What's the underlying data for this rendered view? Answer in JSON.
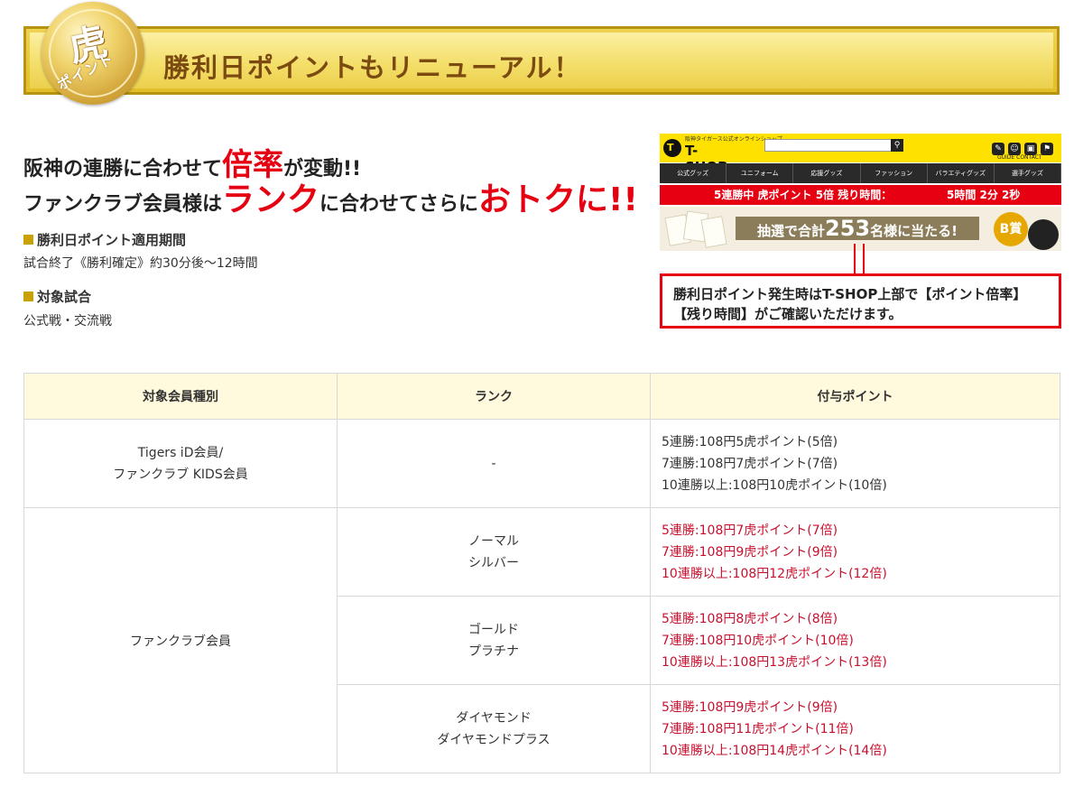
{
  "banner": {
    "medal_kanji": "虎",
    "medal_sub": "ポイント",
    "title": "勝利日ポイントもリニューアル！"
  },
  "headline": {
    "l1_a": "阪神の連勝に合わせて",
    "l1_big": "倍率",
    "l1_b": "が変動!!",
    "l2_a": "ファンクラブ会員様は",
    "l2_big1": "ランク",
    "l2_b": "に合わせてさらに",
    "l2_big2": "おトクに!!"
  },
  "period": {
    "heading": "勝利日ポイント適用期間",
    "text": "試合終了《勝利確定》約30分後〜12時間"
  },
  "target": {
    "heading": "対象試合",
    "text": "公式戦・交流戦"
  },
  "shop_screenshot": {
    "logo_caption": "阪神タイガース公式オンラインショップ",
    "logo_text": "T-SHOP",
    "guide_text": "GUIDE  CONTACT",
    "nav": [
      "公式グッズ",
      "ユニフォーム",
      "応援グッズ",
      "ファッション",
      "バラエティグッズ",
      "選手グッズ"
    ],
    "red_bar_a": "5連勝中 虎ポイント 5倍 残り時間：",
    "red_bar_b": "5時間 2分 2秒",
    "lottery_a": "抽選で合計",
    "lottery_num": "253",
    "lottery_b": "名様に当たる!",
    "prize": "B賞"
  },
  "callout": {
    "line1": "勝利日ポイント発生時はT-SHOP上部で【ポイント倍率】",
    "line2": "【残り時間】がご確認いただけます。"
  },
  "table": {
    "headers": [
      "対象会員種別",
      "ランク",
      "付与ポイント"
    ],
    "row1": {
      "type_l1": "Tigers iD会員/",
      "type_l2": "ファンクラブ KIDS会員",
      "rank": "-",
      "pts": [
        "5連勝:108円5虎ポイント(5倍)",
        "7連勝:108円7虎ポイント(7倍)",
        "10連勝以上:108円10虎ポイント(10倍)"
      ]
    },
    "fc_type": "ファンクラブ会員",
    "row2": {
      "rank_l1": "ノーマル",
      "rank_l2": "シルバー",
      "pts": [
        "5連勝:108円7虎ポイント(7倍)",
        "7連勝:108円9虎ポイント(9倍)",
        "10連勝以上:108円12虎ポイント(12倍)"
      ]
    },
    "row3": {
      "rank_l1": "ゴールド",
      "rank_l2": "プラチナ",
      "pts": [
        "5連勝:108円8虎ポイント(8倍)",
        "7連勝:108円10虎ポイント(10倍)",
        "10連勝以上:108円13虎ポイント(13倍)"
      ]
    },
    "row4": {
      "rank_l1": "ダイヤモンド",
      "rank_l2": "ダイヤモンドプラス",
      "pts": [
        "5連勝:108円9虎ポイント(9倍)",
        "7連勝:108円11虎ポイント(11倍)",
        "10連勝以上:108円14虎ポイント(14倍)"
      ]
    }
  },
  "colors": {
    "accent_red": "#e60012",
    "point_red": "#c8102e",
    "gold": "#e3bd2a",
    "header_bg": "#fff9dd"
  }
}
